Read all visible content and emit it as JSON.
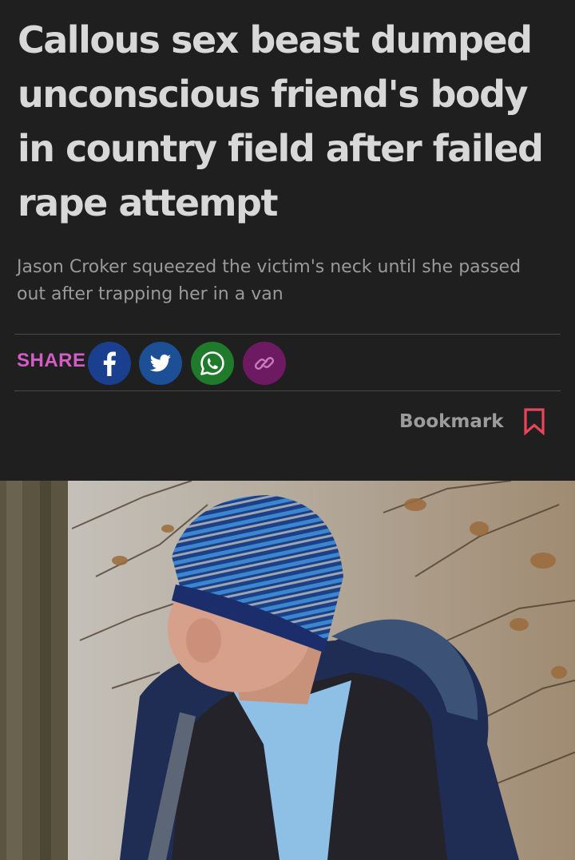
{
  "article": {
    "headline": "Callous sex beast dumped unconscious friend's body in country field after failed rape attempt",
    "standfirst": "Jason Croker squeezed the victim's neck until she passed out after trapping her in a van"
  },
  "share": {
    "label": "SHARE",
    "buttons": [
      {
        "name": "facebook",
        "icon": "facebook-icon",
        "color": "#1b3f8f"
      },
      {
        "name": "twitter",
        "icon": "twitter-icon",
        "color": "#1c4f96"
      },
      {
        "name": "whatsapp",
        "icon": "whatsapp-icon",
        "color": "#1f7a2b"
      },
      {
        "name": "copy-link",
        "icon": "link-icon",
        "color": "#6e1a63"
      }
    ]
  },
  "bookmark": {
    "label": "Bookmark",
    "icon": "bookmark-icon",
    "color": "#e8455b"
  },
  "colors": {
    "background": "#1f1f1f",
    "headline": "#d8d8d8",
    "standfirst": "#9a9a9a",
    "share_label": "#d05ec4"
  }
}
